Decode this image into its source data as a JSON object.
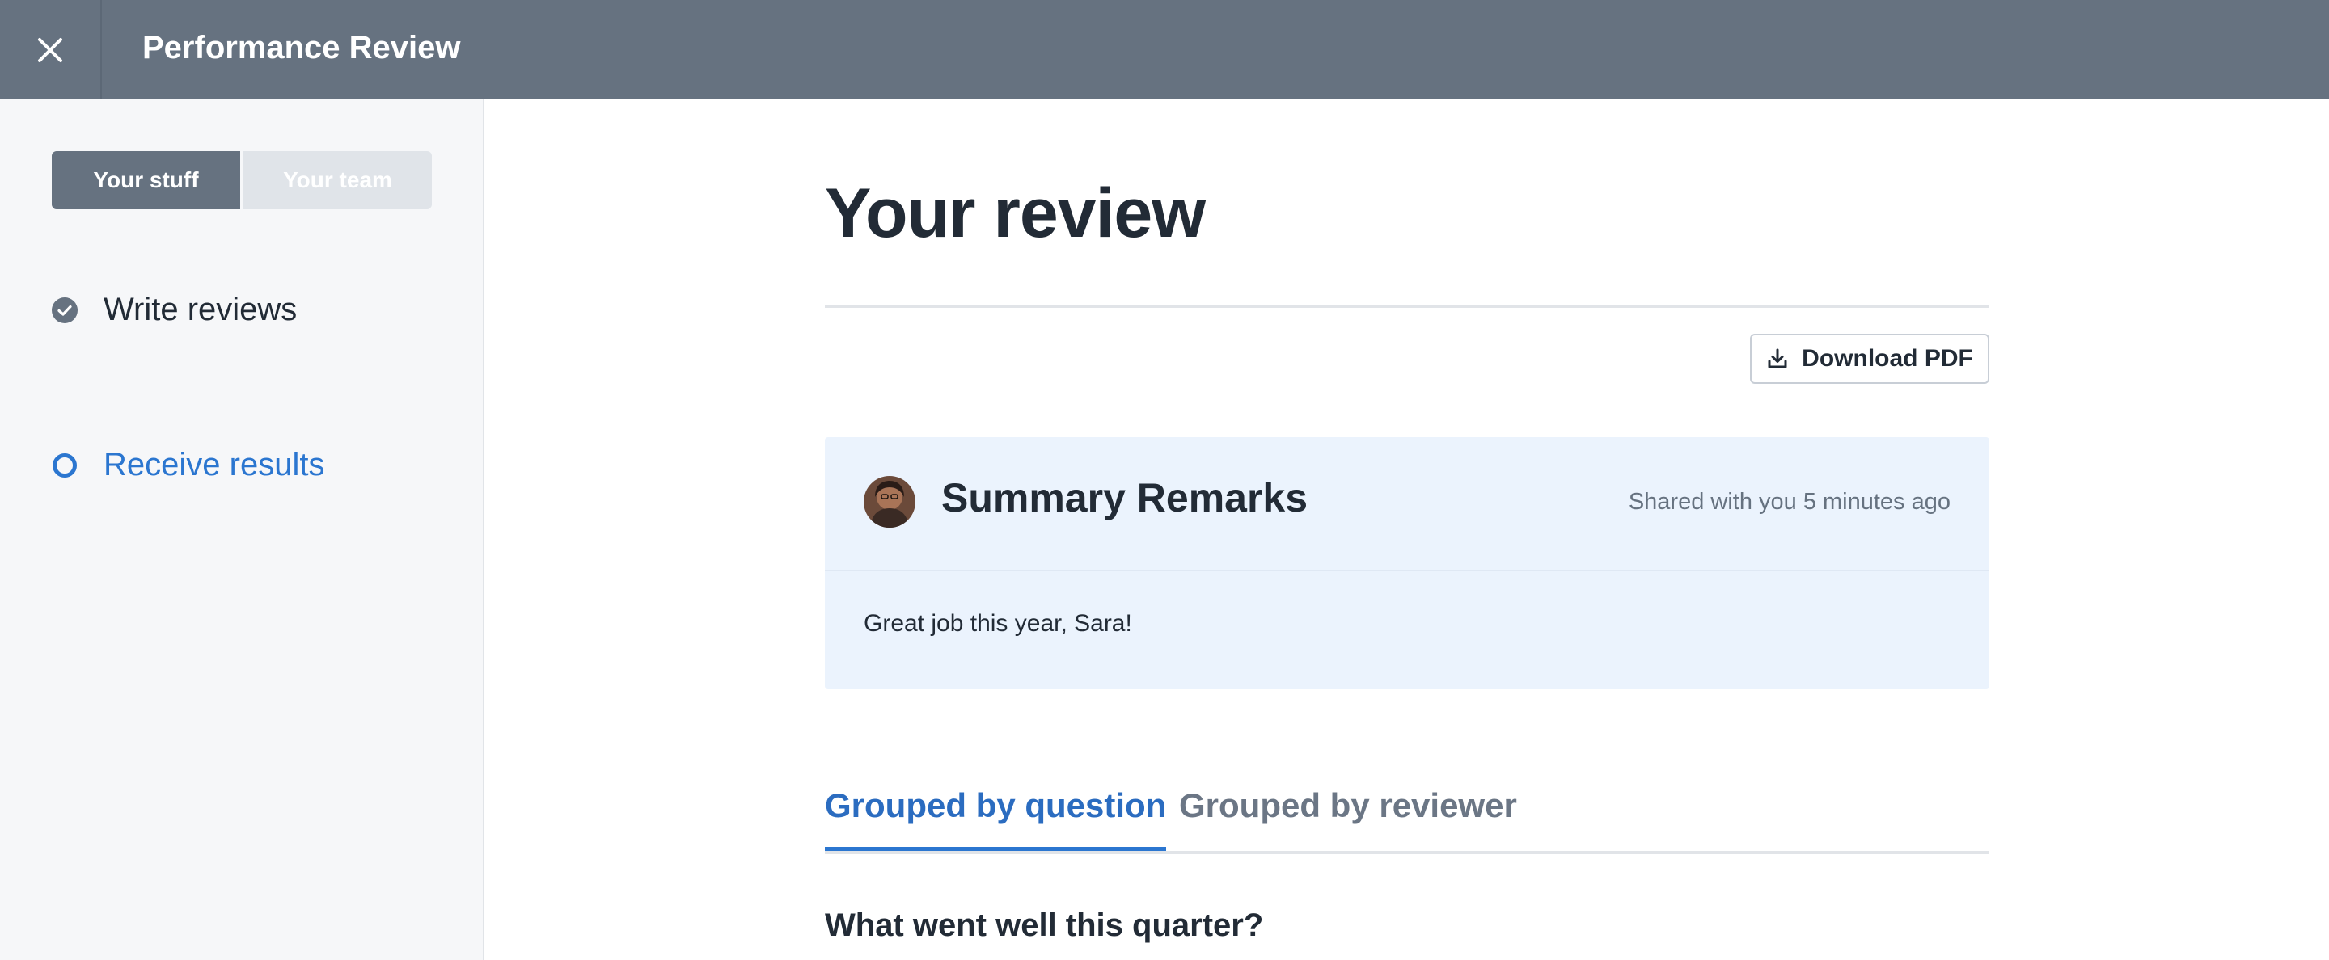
{
  "header": {
    "title": "Performance Review",
    "close_icon": "close-icon"
  },
  "sidebar": {
    "segments": [
      {
        "label": "Your stuff",
        "active": true
      },
      {
        "label": "Your team",
        "active": false
      }
    ],
    "steps": [
      {
        "label": "Write reviews",
        "status": "complete",
        "icon": "check-circle-icon"
      },
      {
        "label": "Receive results",
        "status": "current",
        "icon": "empty-circle-icon"
      }
    ]
  },
  "main": {
    "title": "Your review",
    "download_label": "Download PDF",
    "summary": {
      "title": "Summary Remarks",
      "shared": "Shared with you 5 minutes ago",
      "body": "Great job this year, Sara!"
    },
    "tabs": [
      {
        "label": "Grouped by question",
        "active": true
      },
      {
        "label": "Grouped by reviewer",
        "active": false
      }
    ],
    "question": "What went well this quarter?"
  },
  "colors": {
    "header_bg": "#667280",
    "accent": "#2b76d0",
    "summary_bg": "#ebf3fd",
    "sidebar_bg": "#f6f7f9"
  }
}
